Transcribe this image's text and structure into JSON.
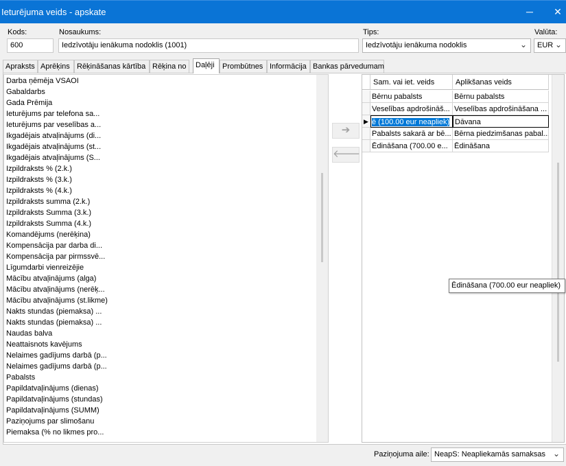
{
  "window": {
    "title": "Ieturējuma veids - apskate",
    "minimize_glyph": "─",
    "close_glyph": "✕"
  },
  "header": {
    "kods_label": "Kods:",
    "kods_value": "600",
    "nosaukums_label": "Nosaukums:",
    "nosaukums_value": "Iedzīvotāju ienākuma nodoklis (1001)",
    "tips_label": "Tips:",
    "tips_value": "Iedzīvotāju ienākuma nodoklis",
    "valuta_label": "Valūta:",
    "valuta_value": "EUR"
  },
  "tabs": [
    "Apraksts",
    "Aprēķins",
    "Rēķināšanas kārtība",
    "Rēķina no",
    "Daļēji",
    "Prombūtnes",
    "Informācija",
    "Bankas pārvedumam"
  ],
  "active_tab": "Daļēji",
  "available_list": [
    "Darba ņēmēja VSAOI",
    "Gabaldarbs",
    "Gada Prēmija",
    "Ieturējums par telefona sa...",
    "Ieturējums par veselības a...",
    "Ikgadējais atvaļinājums (di...",
    "Ikgadējais atvaļinājums (st...",
    "Ikgadējais atvaļinājums (S...",
    "Izpildraksts % (2.k.)",
    "Izpildraksts % (3.k.)",
    "Izpildraksts % (4.k.)",
    "Izpildraksts summa (2.k.)",
    "Izpildraksts Summa (3.k.)",
    "Izpildraksts Summa (4.k.)",
    "Komandējums (nerēķina)",
    "Kompensācija par darba di...",
    "Kompensācija par pirmssvē...",
    "Līgumdarbi vienreizējie",
    "Mācību atvaļinājums (alga)",
    "Mācību atvaļinājums (nerēķ...",
    "Mācību atvaļinājums (st.likme)",
    "Nakts stundas (piemaksa) ...",
    "Nakts stundas (piemaksa) ...",
    "Naudas balva",
    "Neattaisnots kavējums",
    "Nelaimes gadījums darbā (p...",
    "Nelaimes gadījums darbā (p...",
    "Pabalsts",
    "Papildatvaļinājums (dienas)",
    "Papildatvaļinājums (stundas)",
    "Papildatvaļinājums (SUMM)",
    "Paziņojums par slimošanu",
    "Piemaksa (% no likmes pro..."
  ],
  "move_buttons": {
    "add_glyph": "➔",
    "remove_glyph": "🡐"
  },
  "selected_grid": {
    "columns": [
      "Sam. vai iet. veids",
      "Aplikšanas veids"
    ],
    "rows": [
      [
        "Bērnu pabalsts",
        "Bērnu pabalsts"
      ],
      [
        "Veselības apdrošināš...",
        "Veselības apdrošināšana ..."
      ],
      [
        "ē (100.00 eur neapliek)",
        "Dāvana"
      ],
      [
        "Pabalsts sakarā ar bē...",
        "Bērna piedzimšanas pabal..."
      ],
      [
        "Ēdināšana (700.00 e...",
        "Ēdināšana"
      ]
    ],
    "current_row_marker": "▶"
  },
  "tooltip": "Ēdināšana (700.00 eur neapliek)",
  "footer": {
    "pazinojuma_label": "Paziņojuma aile:",
    "pazinojuma_value": "NeapS: Neapliekamās samaksas"
  },
  "colors": {
    "titlebar": "#0a74d6",
    "selection": "#0078d7"
  }
}
